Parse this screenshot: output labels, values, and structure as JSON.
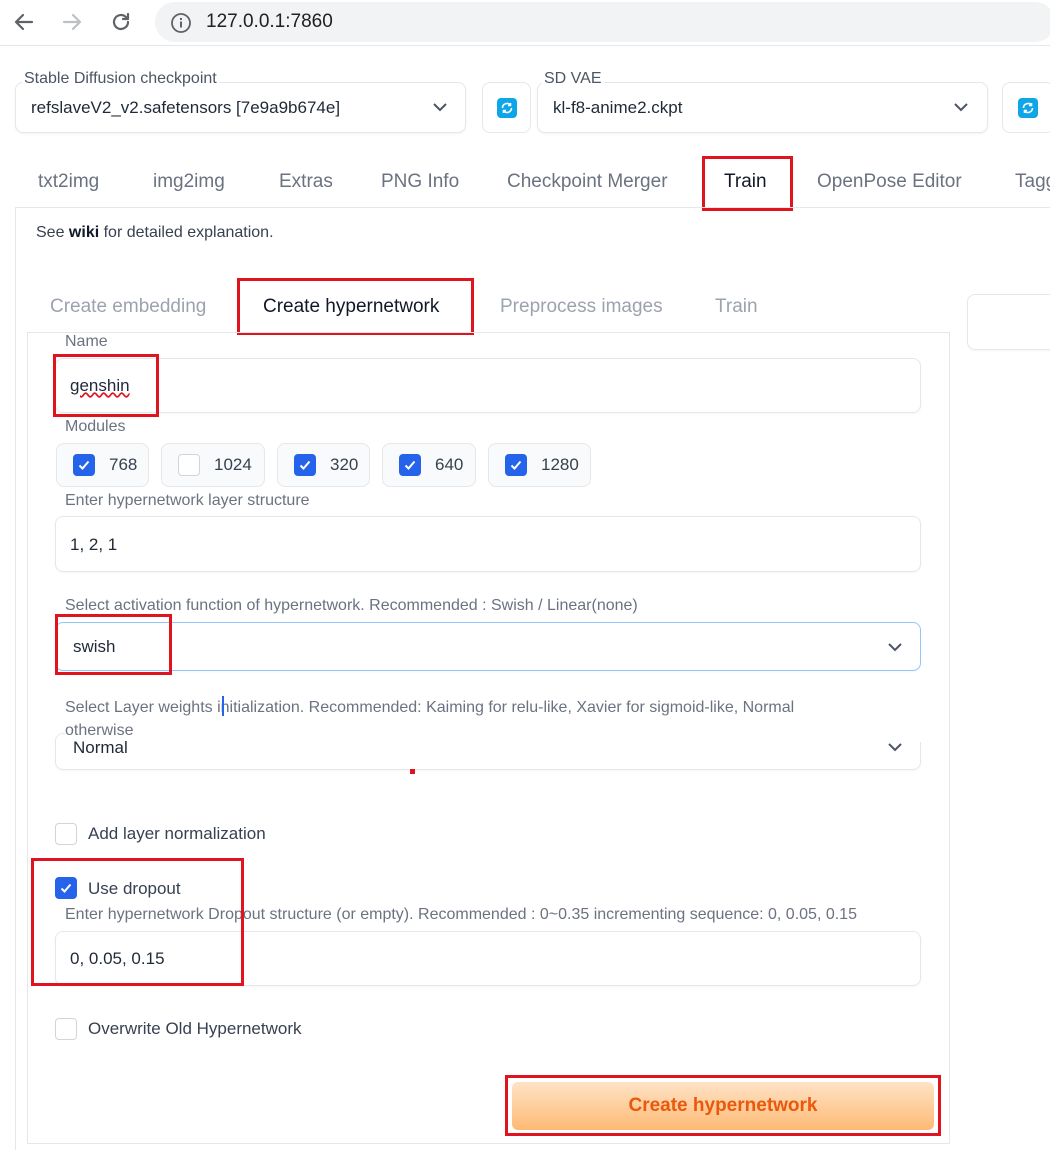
{
  "browser": {
    "url": "127.0.0.1:7860"
  },
  "top": {
    "checkpoint_label": "Stable Diffusion checkpoint",
    "checkpoint_value": "refslaveV2_v2.safetensors [7e9a9b674e]",
    "vae_label": "SD VAE",
    "vae_value": "kl-f8-anime2.ckpt"
  },
  "tabs": [
    "txt2img",
    "img2img",
    "Extras",
    "PNG Info",
    "Checkpoint Merger",
    "Train",
    "OpenPose Editor",
    "Tagg"
  ],
  "active_tab": "Train",
  "wiki_note": {
    "prefix": "See",
    "link": "wiki",
    "suffix": "for detailed explanation."
  },
  "subtabs": [
    "Create embedding",
    "Create hypernetwork",
    "Preprocess images",
    "Train"
  ],
  "active_subtab": "Create hypernetwork",
  "form": {
    "name_label": "Name",
    "name_value": "genshin",
    "modules_label": "Modules",
    "modules": [
      {
        "label": "768",
        "checked": true
      },
      {
        "label": "1024",
        "checked": false
      },
      {
        "label": "320",
        "checked": true
      },
      {
        "label": "640",
        "checked": true
      },
      {
        "label": "1280",
        "checked": true
      }
    ],
    "layer_structure_label": "Enter hypernetwork layer structure",
    "layer_structure_value": "1, 2, 1",
    "activation_label": "Select activation function of hypernetwork. Recommended : Swish / Linear(none)",
    "activation_value": "swish",
    "init_label_line1": "Select Layer weights initialization. Recommended: Kaiming for relu-like, Xavier for sigmoid-like, Normal",
    "init_label_line2": "otherwise",
    "init_value": "Normal",
    "layer_norm_label": "Add layer normalization",
    "layer_norm_checked": false,
    "dropout_label": "Use dropout",
    "dropout_checked": true,
    "dropout_structure_label": "Enter hypernetwork Dropout structure (or empty). Recommended : 0~0.35 incrementing sequence: 0, 0.05, 0.15",
    "dropout_structure_value": "0, 0.05, 0.15",
    "overwrite_label": "Overwrite Old Hypernetwork",
    "overwrite_checked": false,
    "create_button": "Create hypernetwork"
  },
  "colors": {
    "accent": "#2563eb",
    "button_text": "#ea580c",
    "highlight": "#e0141e",
    "refresh": "#0ea5e9"
  }
}
